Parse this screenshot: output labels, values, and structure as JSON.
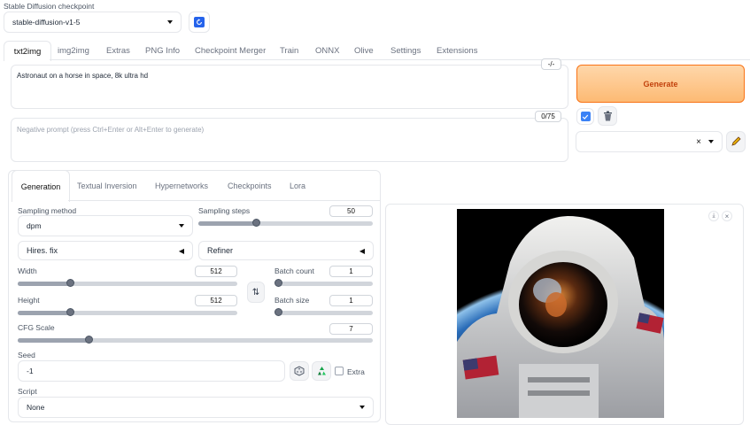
{
  "checkpoint": {
    "label": "Stable Diffusion checkpoint",
    "value": "stable-diffusion-v1-5"
  },
  "tabs": [
    {
      "label": "txt2img"
    },
    {
      "label": "img2img"
    },
    {
      "label": "Extras"
    },
    {
      "label": "PNG Info"
    },
    {
      "label": "Checkpoint Merger"
    },
    {
      "label": "Train"
    },
    {
      "label": "ONNX"
    },
    {
      "label": "Olive"
    },
    {
      "label": "Settings"
    },
    {
      "label": "Extensions"
    }
  ],
  "prompt": {
    "value": "Astronaut on a horse in space, 8k ultra hd",
    "token_count": "-/-"
  },
  "negative_prompt": {
    "placeholder": "Negative prompt (press Ctrl+Enter or Alt+Enter to generate)",
    "token_count": "0/75"
  },
  "generate_label": "Generate",
  "subtabs": [
    {
      "label": "Generation"
    },
    {
      "label": "Textual Inversion"
    },
    {
      "label": "Hypernetworks"
    },
    {
      "label": "Checkpoints"
    },
    {
      "label": "Lora"
    }
  ],
  "sampling_method": {
    "label": "Sampling method",
    "value": "dpm"
  },
  "sampling_steps": {
    "label": "Sampling steps",
    "value": "50",
    "fraction": 0.33
  },
  "hires_fix": {
    "label": "Hires. fix"
  },
  "refiner": {
    "label": "Refiner"
  },
  "width": {
    "label": "Width",
    "value": "512",
    "fraction": 0.24
  },
  "height": {
    "label": "Height",
    "value": "512",
    "fraction": 0.24
  },
  "batch_count": {
    "label": "Batch count",
    "value": "1",
    "fraction": 0.0
  },
  "batch_size": {
    "label": "Batch size",
    "value": "1",
    "fraction": 0.0
  },
  "cfg_scale": {
    "label": "CFG Scale",
    "value": "7",
    "fraction": 0.2
  },
  "seed": {
    "label": "Seed",
    "value": "-1"
  },
  "extra": {
    "label": "Extra"
  },
  "script": {
    "label": "Script",
    "value": "None"
  },
  "colors": {
    "accent": "#f97316",
    "generate_bg": "#fdba74",
    "checkbox": "#3b82f6"
  },
  "icons": [
    "refresh-icon",
    "paint-palette-icon",
    "trash-icon",
    "pencil-icon",
    "swap-icon",
    "dice-icon",
    "recycle-icon",
    "download-icon",
    "close-icon"
  ]
}
